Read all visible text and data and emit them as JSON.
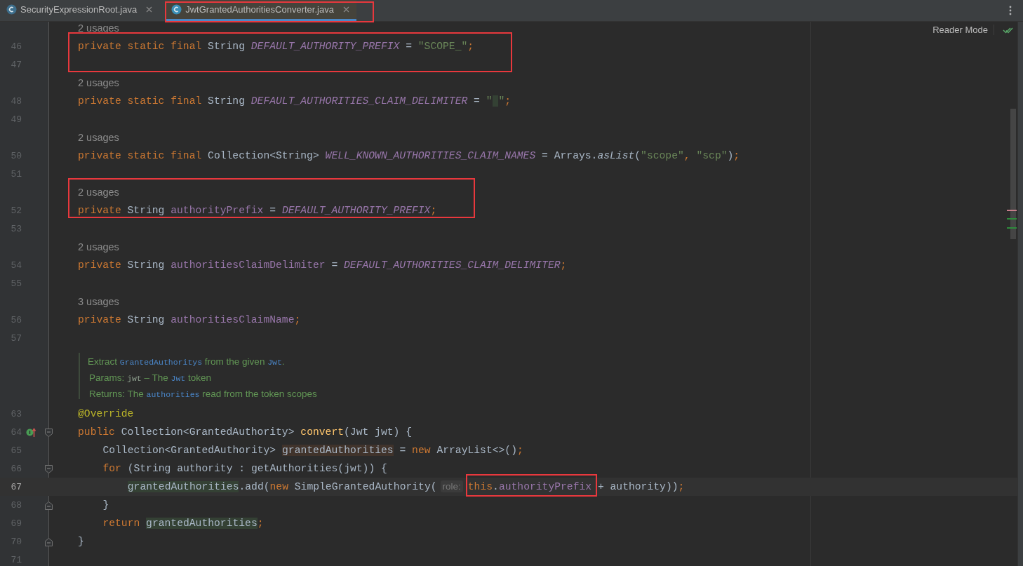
{
  "tabs": [
    {
      "label": "SecurityExpressionRoot.java",
      "selected": false
    },
    {
      "label": "JwtGrantedAuthoritiesConverter.java",
      "selected": true,
      "boxed": true
    }
  ],
  "reader_mode": {
    "label": "Reader Mode"
  },
  "editor": {
    "rows": [
      {
        "kind": "usages",
        "text": "2 usages"
      },
      {
        "kind": "code",
        "n": "46",
        "current": false,
        "boxed": true,
        "tokens": [
          {
            "text": "private static final",
            "kind": "keyword"
          },
          {
            "text": " String ",
            "kind": "plain"
          },
          {
            "text": "DEFAULT_AUTHORITY_PREFIX",
            "kind": "constant"
          },
          {
            "text": " = ",
            "kind": "plain"
          },
          {
            "text": "\"SCOPE_\"",
            "kind": "string"
          },
          {
            "text": ";",
            "kind": "keyword"
          }
        ]
      },
      {
        "kind": "code",
        "n": "47",
        "current": false,
        "boxed": true
      },
      {
        "kind": "usages",
        "text": "2 usages"
      },
      {
        "kind": "code",
        "n": "48",
        "current": false,
        "tokens": [
          {
            "text": "private static final",
            "kind": "keyword"
          },
          {
            "text": " String ",
            "kind": "plain"
          },
          {
            "text": "DEFAULT_AUTHORITIES_CLAIM_DELIMITER",
            "kind": "constant"
          },
          {
            "text": " = ",
            "kind": "plain"
          },
          {
            "text": "\" \"",
            "kind": "string-selected-inside"
          },
          {
            "text": ";",
            "kind": "keyword"
          }
        ]
      },
      {
        "kind": "code",
        "n": "49",
        "current": false
      },
      {
        "kind": "usages",
        "text": "2 usages"
      },
      {
        "kind": "code",
        "n": "50",
        "current": false,
        "tokens": [
          {
            "text": "private static final",
            "kind": "keyword"
          },
          {
            "text": " Collection<String> ",
            "kind": "plain"
          },
          {
            "text": "WELL_KNOWN_AUTHORITIES_CLAIM_NAMES",
            "kind": "constant"
          },
          {
            "text": " = Arrays.",
            "kind": "plain"
          },
          {
            "text": "asList",
            "kind": "static-call"
          },
          {
            "text": "(",
            "kind": "plain"
          },
          {
            "text": "\"scope\"",
            "kind": "string"
          },
          {
            "text": ", ",
            "kind": "keyword"
          },
          {
            "text": "\"scp\"",
            "kind": "string"
          },
          {
            "text": ")",
            "kind": "plain"
          },
          {
            "text": ";",
            "kind": "keyword"
          }
        ]
      },
      {
        "kind": "code",
        "n": "51",
        "current": false
      },
      {
        "kind": "usages",
        "text": "2 usages",
        "boxed": true
      },
      {
        "kind": "code",
        "n": "52",
        "current": false,
        "boxed": true,
        "tokens": [
          {
            "text": "private",
            "kind": "keyword"
          },
          {
            "text": " String ",
            "kind": "plain"
          },
          {
            "text": "authorityPrefix",
            "kind": "field"
          },
          {
            "text": " = ",
            "kind": "plain"
          },
          {
            "text": "DEFAULT_AUTHORITY_PREFIX",
            "kind": "constant"
          },
          {
            "text": ";",
            "kind": "keyword"
          }
        ]
      },
      {
        "kind": "code",
        "n": "53",
        "current": false
      },
      {
        "kind": "usages",
        "text": "2 usages"
      },
      {
        "kind": "code",
        "n": "54",
        "current": false,
        "tokens": [
          {
            "text": "private",
            "kind": "keyword"
          },
          {
            "text": " String ",
            "kind": "plain"
          },
          {
            "text": "authoritiesClaimDelimiter",
            "kind": "field"
          },
          {
            "text": " = ",
            "kind": "plain"
          },
          {
            "text": "DEFAULT_AUTHORITIES_CLAIM_DELIMITER",
            "kind": "constant"
          },
          {
            "text": ";",
            "kind": "keyword"
          }
        ]
      },
      {
        "kind": "code",
        "n": "55",
        "current": false
      },
      {
        "kind": "usages",
        "text": "3 usages"
      },
      {
        "kind": "code",
        "n": "56",
        "current": false,
        "tokens": [
          {
            "text": "private",
            "kind": "keyword"
          },
          {
            "text": " String ",
            "kind": "plain"
          },
          {
            "text": "authoritiesClaimName",
            "kind": "field"
          },
          {
            "text": ";",
            "kind": "keyword"
          }
        ]
      },
      {
        "kind": "code",
        "n": "57",
        "current": false
      },
      {
        "kind": "doc",
        "lines": [
          [
            {
              "text": "Extract ",
              "kind": "text"
            },
            {
              "text": "GrantedAuthoritys",
              "kind": "code"
            },
            {
              "text": " from the given ",
              "kind": "text"
            },
            {
              "text": "Jwt",
              "kind": "code"
            },
            {
              "text": ".",
              "kind": "text"
            }
          ],
          [
            {
              "text": "Params: ",
              "kind": "text"
            },
            {
              "text": "jwt",
              "kind": "param"
            },
            {
              "text": " – The ",
              "kind": "text"
            },
            {
              "text": "Jwt",
              "kind": "code"
            },
            {
              "text": " token",
              "kind": "text"
            }
          ],
          [
            {
              "text": "Returns: The ",
              "kind": "text"
            },
            {
              "text": "authorities",
              "kind": "code"
            },
            {
              "text": " read from the token scopes",
              "kind": "text"
            }
          ]
        ]
      },
      {
        "kind": "code",
        "n": "63",
        "current": false,
        "tokens": [
          {
            "text": "@Override",
            "kind": "annotation"
          }
        ]
      },
      {
        "kind": "code",
        "n": "64",
        "current": false,
        "implements": true,
        "fold_start": true,
        "tokens": [
          {
            "text": "public",
            "kind": "keyword"
          },
          {
            "text": " Collection<GrantedAuthority> ",
            "kind": "plain"
          },
          {
            "text": "convert",
            "kind": "method"
          },
          {
            "text": "(Jwt jwt) {",
            "kind": "plain"
          }
        ],
        "children": [
          {
            "kind": "code",
            "n": "65",
            "current": false,
            "tokens": [
              {
                "text": "Collection<GrantedAuthority> ",
                "kind": "plain"
              },
              {
                "text": "grantedAuthorities",
                "kind": "write-usage"
              },
              {
                "text": " = ",
                "kind": "plain"
              },
              {
                "text": "new",
                "kind": "keyword"
              },
              {
                "text": " ArrayList<>()",
                "kind": "plain"
              },
              {
                "text": ";",
                "kind": "keyword"
              }
            ]
          },
          {
            "kind": "code",
            "n": "66",
            "current": false,
            "fold_start": true,
            "tokens": [
              {
                "text": "for",
                "kind": "keyword"
              },
              {
                "text": " (String authority : getAuthorities(jwt)) {",
                "kind": "plain"
              }
            ],
            "children": [
              {
                "kind": "code",
                "n": "67",
                "current": true,
                "tokens": [
                  {
                    "text": "grantedAuthorities",
                    "kind": "read-usage"
                  },
                  {
                    "text": ".add(",
                    "kind": "plain"
                  },
                  {
                    "text": "new",
                    "kind": "keyword"
                  },
                  {
                    "text": " SimpleGrantedAuthority(",
                    "kind": "plain"
                  },
                  {
                    "text": "role:",
                    "kind": "hint"
                  },
                  {
                    "text": "this",
                    "kind": "keyword",
                    "boxed": true
                  },
                  {
                    "text": ".",
                    "kind": "plain",
                    "boxed": true
                  },
                  {
                    "text": "authorityPrefix",
                    "kind": "field",
                    "boxed": true
                  },
                  {
                    "text": " + authority))",
                    "kind": "plain"
                  },
                  {
                    "text": ";",
                    "kind": "keyword"
                  }
                ]
              }
            ]
          },
          {
            "kind": "code",
            "n": "68",
            "current": false,
            "fold_end": true,
            "tokens": [
              {
                "text": "}",
                "kind": "plain"
              }
            ]
          },
          {
            "kind": "code",
            "n": "69",
            "current": false,
            "tokens": [
              {
                "text": "return ",
                "kind": "keyword"
              },
              {
                "text": "grantedAuthorities",
                "kind": "read-usage"
              },
              {
                "text": ";",
                "kind": "keyword"
              }
            ]
          }
        ]
      },
      {
        "kind": "code",
        "n": "70",
        "current": false,
        "fold_end": true,
        "tokens": [
          {
            "text": "}",
            "kind": "plain"
          }
        ]
      },
      {
        "kind": "code",
        "n": "71",
        "current": false
      }
    ]
  }
}
